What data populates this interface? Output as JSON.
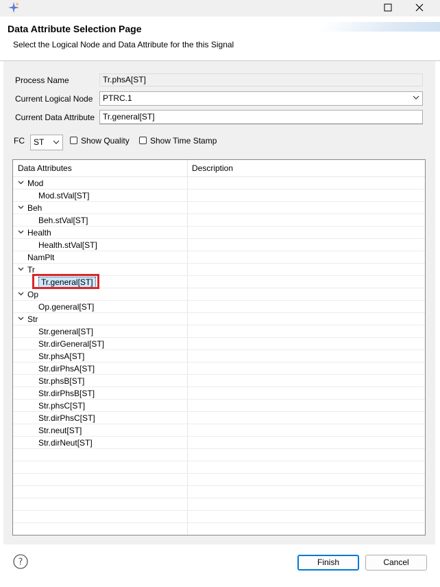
{
  "titlebar": {
    "maximize_glyph": "☐",
    "close_glyph": "✕",
    "app_icon": "sparkle-icon"
  },
  "header": {
    "title": "Data Attribute Selection Page",
    "description": "Select the Logical Node and Data Attribute for the this Signal"
  },
  "form": {
    "process_name_label": "Process Name",
    "process_name_value": "Tr.phsA[ST]",
    "logical_node_label": "Current Logical Node",
    "logical_node_value": "PTRC.1",
    "data_attribute_label": "Current Data Attribute",
    "data_attribute_value": "Tr.general[ST]",
    "fc_label": "FC",
    "fc_value": "ST",
    "show_quality_label": "Show Quality",
    "show_quality_checked": false,
    "show_timestamp_label": "Show Time Stamp",
    "show_timestamp_checked": false
  },
  "tree": {
    "columns": [
      "Data Attributes",
      "Description"
    ],
    "rows": [
      {
        "label": "Mod",
        "level": 0,
        "expanded": true
      },
      {
        "label": "Mod.stVal[ST]",
        "level": 1
      },
      {
        "label": "Beh",
        "level": 0,
        "expanded": true
      },
      {
        "label": "Beh.stVal[ST]",
        "level": 1
      },
      {
        "label": "Health",
        "level": 0,
        "expanded": true
      },
      {
        "label": "Health.stVal[ST]",
        "level": 1
      },
      {
        "label": "NamPlt",
        "level": 0
      },
      {
        "label": "Tr",
        "level": 0,
        "expanded": true
      },
      {
        "label": "Tr.general[ST]",
        "level": 1,
        "selected": true
      },
      {
        "label": "Op",
        "level": 0,
        "expanded": true
      },
      {
        "label": "Op.general[ST]",
        "level": 1
      },
      {
        "label": "Str",
        "level": 0,
        "expanded": true
      },
      {
        "label": "Str.general[ST]",
        "level": 1
      },
      {
        "label": "Str.dirGeneral[ST]",
        "level": 1
      },
      {
        "label": "Str.phsA[ST]",
        "level": 1
      },
      {
        "label": "Str.dirPhsA[ST]",
        "level": 1
      },
      {
        "label": "Str.phsB[ST]",
        "level": 1
      },
      {
        "label": "Str.dirPhsB[ST]",
        "level": 1
      },
      {
        "label": "Str.phsC[ST]",
        "level": 1
      },
      {
        "label": "Str.dirPhsC[ST]",
        "level": 1
      },
      {
        "label": "Str.neut[ST]",
        "level": 1
      },
      {
        "label": "Str.dirNeut[ST]",
        "level": 1
      }
    ]
  },
  "buttons": {
    "finish": "Finish",
    "cancel": "Cancel"
  },
  "colors": {
    "selection": "#cce8ff",
    "highlight": "#d9262a",
    "default_button_border": "#0078d4"
  }
}
